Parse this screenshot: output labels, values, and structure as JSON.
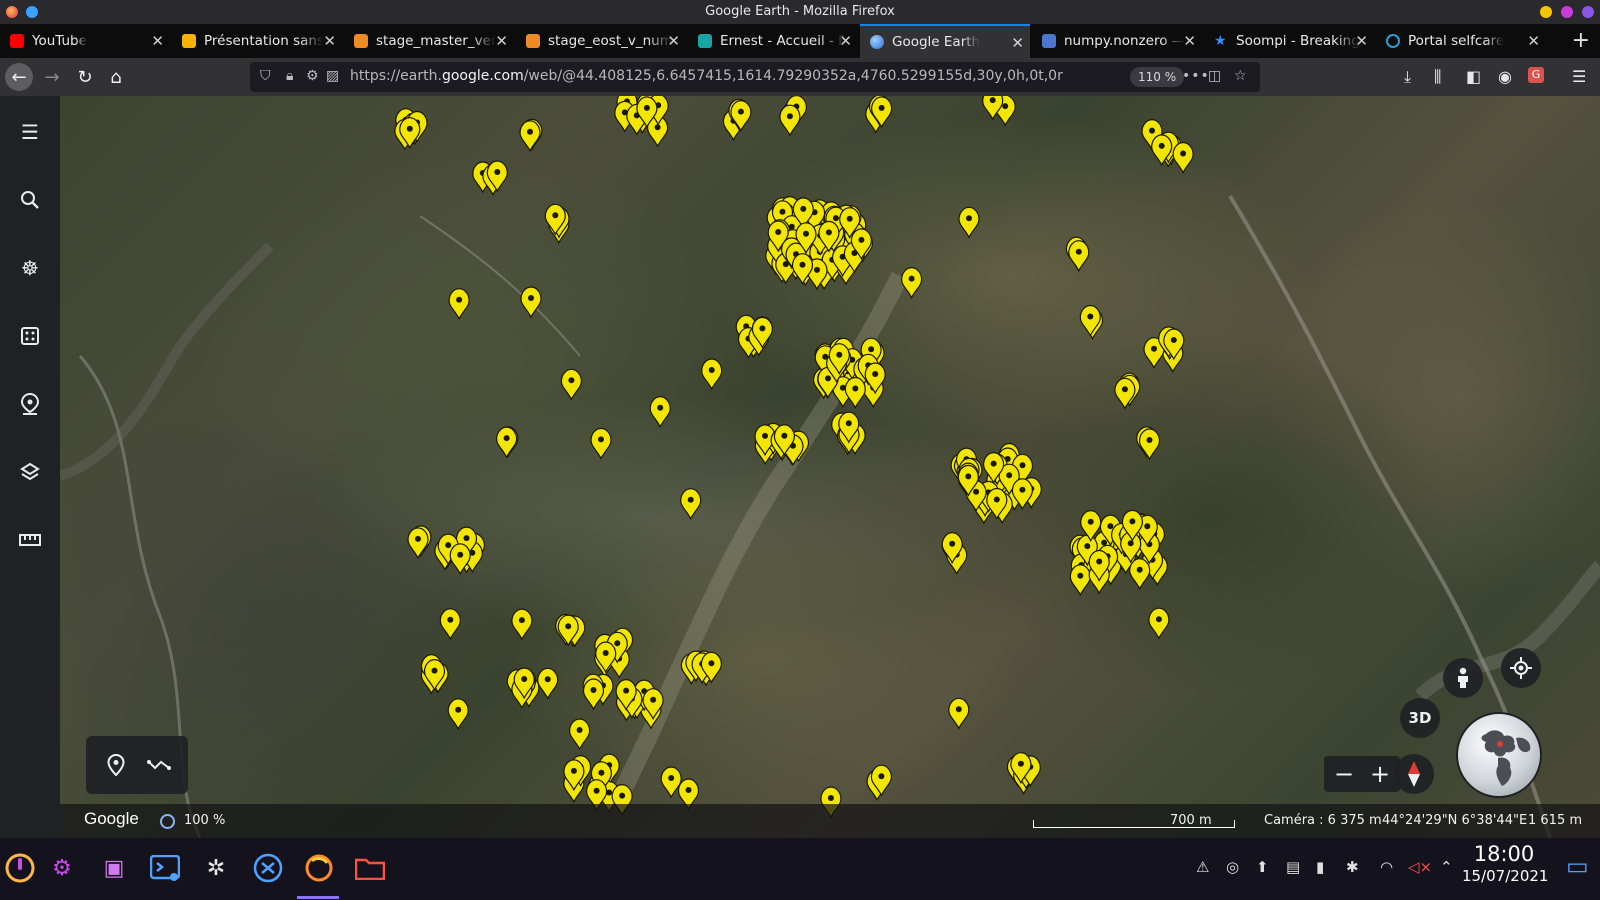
{
  "window": {
    "title": "Google Earth - Mozilla Firefox",
    "colors": {
      "accent": "#0a84ff",
      "pin": "#f2e600"
    }
  },
  "tabs": [
    {
      "label": "YouTube",
      "icon": "youtube-icon",
      "color": "#ff0000",
      "active": false
    },
    {
      "label": "Présentation sans",
      "icon": "slides-icon",
      "color": "#f4b400",
      "active": false
    },
    {
      "label": "stage_master_ver",
      "icon": "overleaf-icon",
      "color": "#f08a24",
      "active": false
    },
    {
      "label": "stage_eost_v_num",
      "icon": "overleaf-icon",
      "color": "#f08a24",
      "active": false
    },
    {
      "label": "Ernest - Accueil - E",
      "icon": "ernest-icon",
      "color": "#1aa3a3",
      "active": false
    },
    {
      "label": "Google Earth",
      "icon": "earth-icon",
      "color": "#4a90e2",
      "active": true
    },
    {
      "label": "numpy.nonzero —",
      "icon": "numpy-icon",
      "color": "#4d77cf",
      "active": false
    },
    {
      "label": "Soompi - Breaking",
      "icon": "star-icon",
      "color": "#3b8bff",
      "active": false
    },
    {
      "label": "Portal selfcare",
      "icon": "portal-icon",
      "color": "#2a9fd6",
      "active": false
    }
  ],
  "navbar": {
    "url_prefix": "https://earth.",
    "url_domain": "google.com",
    "url_path": "/web/@44.408125,6.6457415,1614.79290352a,4760.5299155d,30y,0h,0t,0r",
    "zoom": "110 %"
  },
  "earth": {
    "sidebar_items": [
      {
        "name": "menu",
        "icon": "hamburger-icon"
      },
      {
        "name": "search",
        "icon": "search-icon"
      },
      {
        "name": "voyager",
        "icon": "voyager-wheel-icon"
      },
      {
        "name": "feeling-lucky",
        "icon": "dice-icon"
      },
      {
        "name": "projects",
        "icon": "projects-pin-icon"
      },
      {
        "name": "map-style",
        "icon": "layers-icon"
      },
      {
        "name": "measure",
        "icon": "ruler-icon"
      }
    ],
    "status": {
      "brand": "Google",
      "loading": "100 %",
      "scale": "700 m",
      "camera": "Caméra : 6 375 m",
      "coords": "44°24'29\"N 6°38'44\"E",
      "elevation": "1 615 m"
    },
    "controls": {
      "view_3d": "3D",
      "zoom_out": "−",
      "zoom_in": "+"
    }
  },
  "taskbar": {
    "time": "18:00",
    "date": "15/07/2021",
    "apps": [
      "launcher-icon",
      "settings-icon",
      "store-icon",
      "terminal-icon",
      "network-icon",
      "vscodium-icon",
      "firefox-icon",
      "files-icon"
    ]
  }
}
